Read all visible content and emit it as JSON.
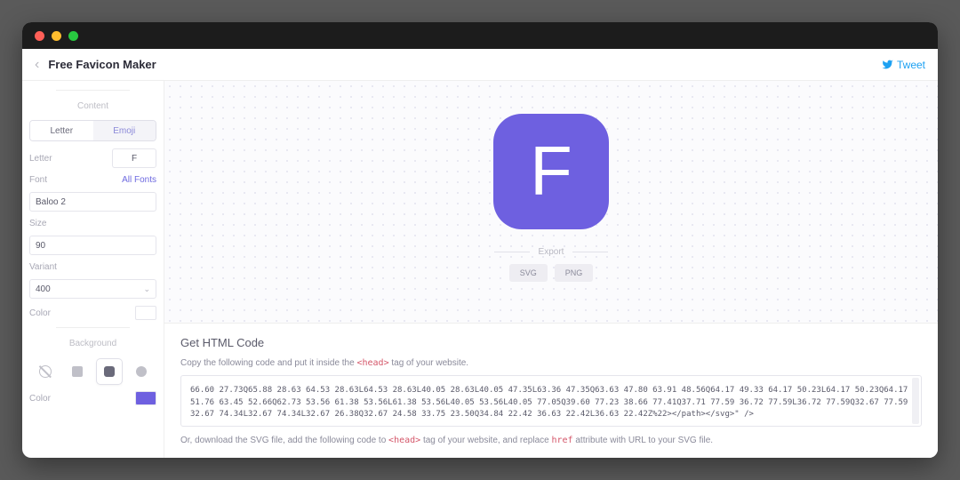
{
  "header": {
    "title": "Free Favicon Maker",
    "tweet": "Tweet"
  },
  "sidebar": {
    "content_label": "Content",
    "tab_letter": "Letter",
    "tab_emoji": "Emoji",
    "letter_label": "Letter",
    "letter_value": "F",
    "font_label": "Font",
    "allfonts_link": "All Fonts",
    "font_value": "Baloo 2",
    "size_label": "Size",
    "size_value": "90",
    "variant_label": "Variant",
    "variant_value": "400",
    "color_label": "Color",
    "background_label": "Background",
    "bgcolor_label": "Color"
  },
  "preview": {
    "letter": "F",
    "export_label": "Export",
    "svg_btn": "SVG",
    "png_btn": "PNG"
  },
  "code": {
    "title": "Get HTML Code",
    "desc_before": "Copy the following code and put it inside the ",
    "desc_tag": "<head>",
    "desc_after": " tag of your website.",
    "snippet": "66.60 27.73Q65.88 28.63 64.53 28.63L64.53 28.63L40.05 28.63L40.05 47.35L63.36 47.35Q63.63 47.80 63.91 48.56Q64.17 49.33 64.17 50.23L64.17 50.23Q64.17 51.76 63.45 52.66Q62.73 53.56 61.38 53.56L61.38 53.56L40.05 53.56L40.05 77.05Q39.60 77.23 38.66 77.41Q37.71 77.59 36.72 77.59L36.72 77.59Q32.67 77.59 32.67 74.34L32.67 74.34L32.67 26.38Q32.67 24.58 33.75 23.50Q34.84 22.42 36.63 22.42L36.63 22.42Z%22></path></svg>\" />",
    "desc2_before": "Or, download the SVG file, add the following code to ",
    "desc2_tag1": "<head>",
    "desc2_mid": " tag of your website, and replace ",
    "desc2_tag2": "href",
    "desc2_after": " attribute with URL to your SVG file."
  }
}
